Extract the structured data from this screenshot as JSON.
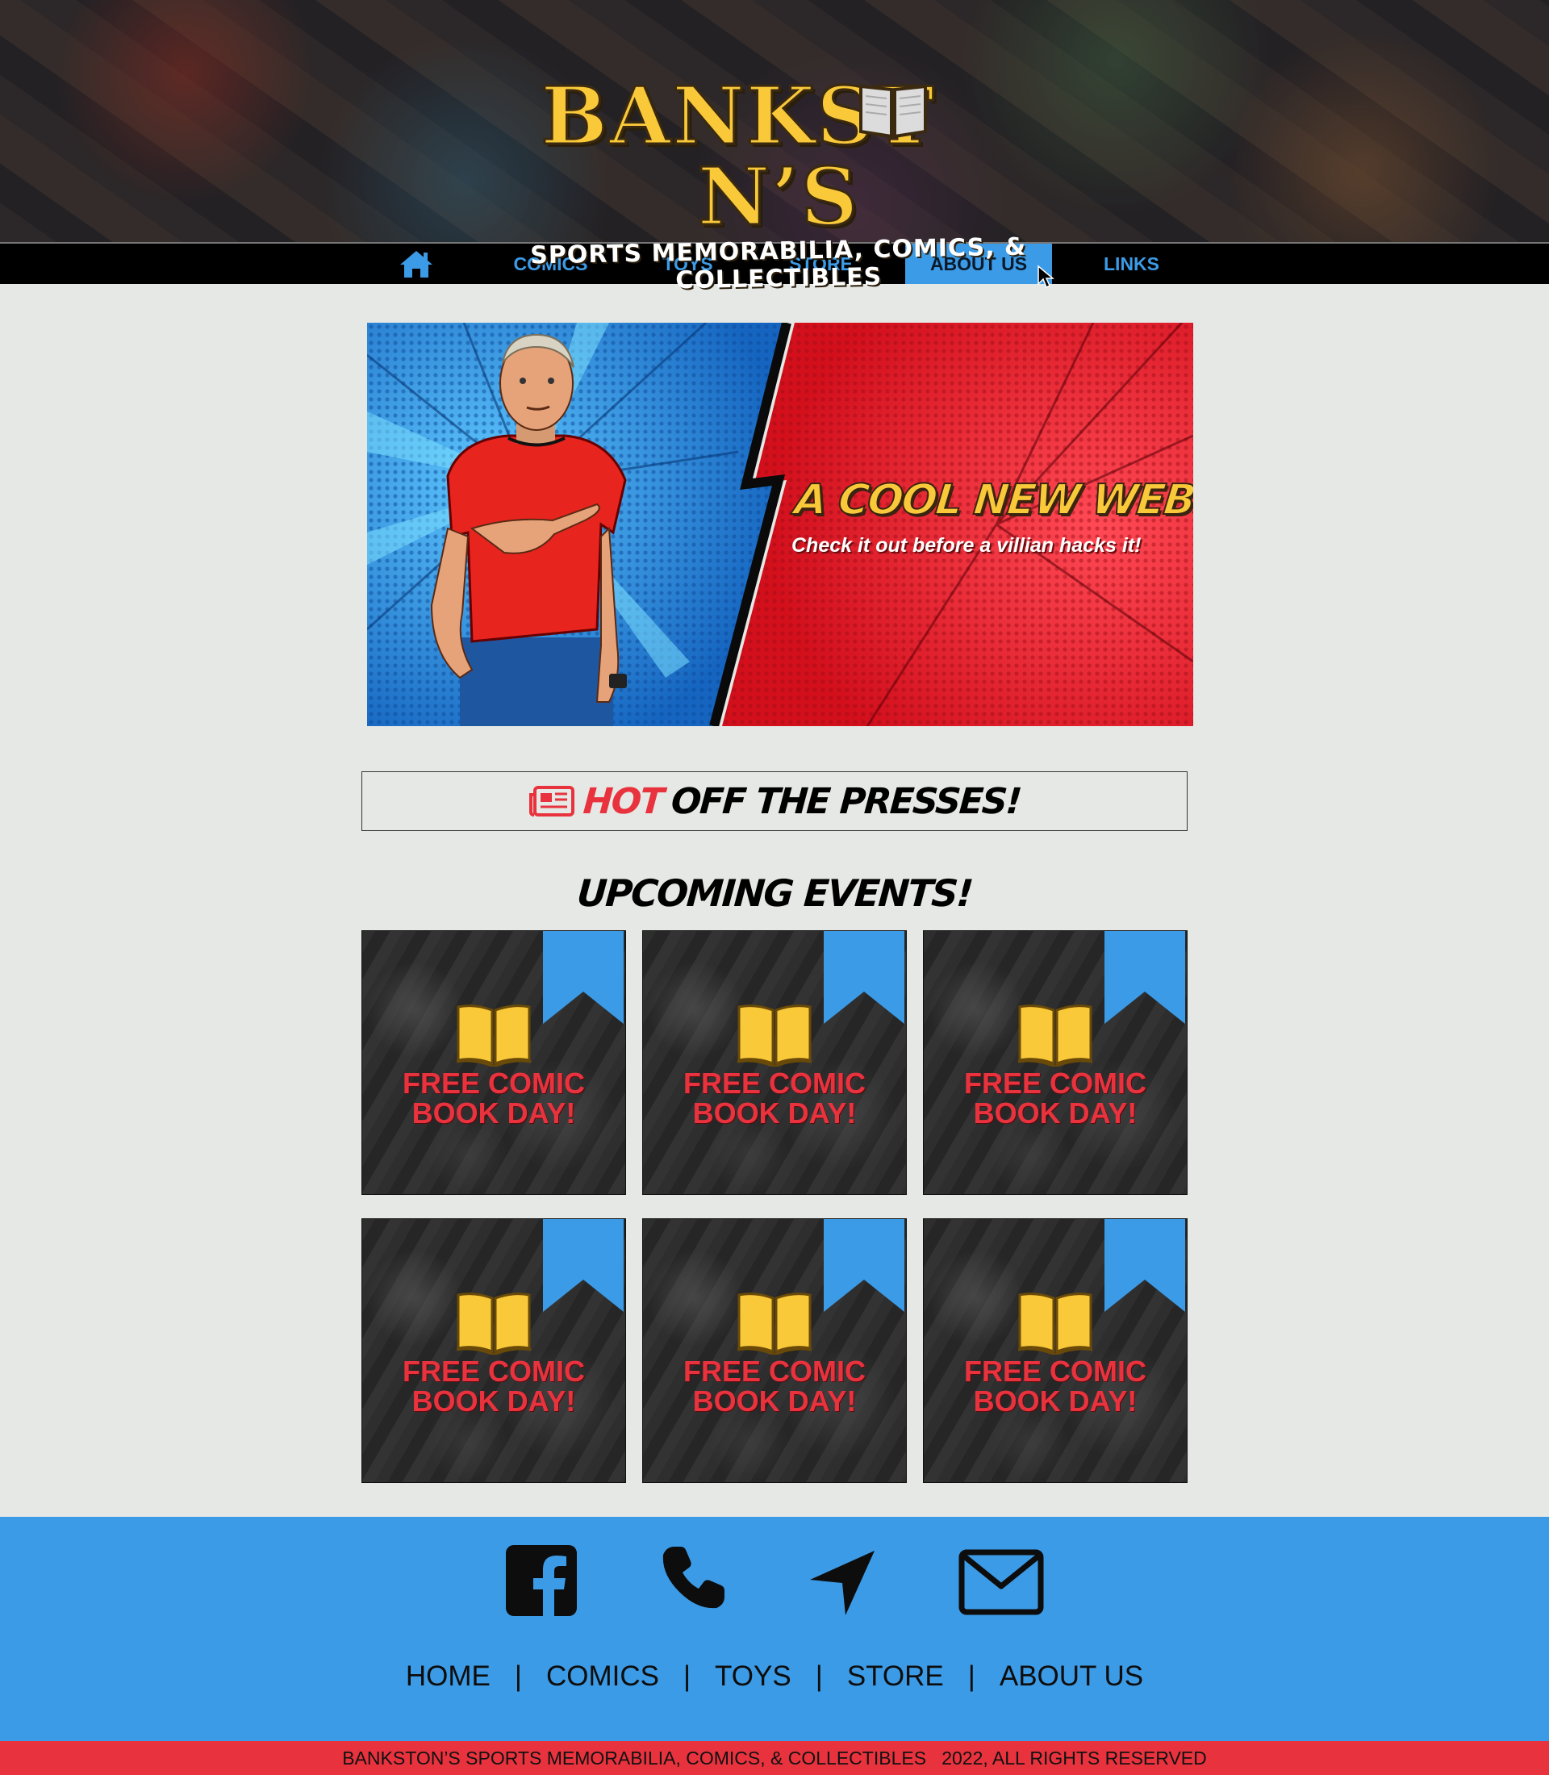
{
  "header": {
    "logo_title": "BANKST N’S",
    "logo_subtitle": "SPORTS MEMORABILIA, COMICS, & COLLECTIBLES"
  },
  "nav": {
    "home_icon": "home-icon",
    "items": [
      {
        "label": "COMICS"
      },
      {
        "label": "TOYS"
      },
      {
        "label": "STORE"
      },
      {
        "label": "ABOUT US",
        "active": true
      },
      {
        "label": "LINKS"
      }
    ]
  },
  "hero": {
    "headline": "A COOL NEW WEBSITE!",
    "subline": "Check it out before a villian hacks it!"
  },
  "hot_section": {
    "icon": "newspaper-icon",
    "hot_word": "HOT",
    "rest": "OFF THE PRESSES!"
  },
  "events": {
    "title": "UPCOMING EVENTS!",
    "cards": [
      {
        "line1": "FREE COMIC",
        "line2": "BOOK DAY!"
      },
      {
        "line1": "FREE COMIC",
        "line2": "BOOK DAY!"
      },
      {
        "line1": "FREE COMIC",
        "line2": "BOOK DAY!"
      },
      {
        "line1": "FREE COMIC",
        "line2": "BOOK DAY!"
      },
      {
        "line1": "FREE COMIC",
        "line2": "BOOK DAY!"
      },
      {
        "line1": "FREE COMIC",
        "line2": "BOOK DAY!"
      }
    ]
  },
  "footer": {
    "social_icons": [
      "facebook-icon",
      "phone-icon",
      "location-arrow-icon",
      "mail-icon"
    ],
    "links": [
      "HOME",
      "COMICS",
      "TOYS",
      "STORE",
      "ABOUT US"
    ],
    "separator": "|",
    "copyright": "BANKSTON’S SPORTS MEMORABILIA, COMICS, & COLLECTIBLES   2022, ALL RIGHTS RESERVED"
  },
  "colors": {
    "accent_blue": "#3c9be6",
    "accent_red": "#e8333e",
    "logo_yellow": "#f9c93a",
    "page_bg": "#e6e8e5"
  }
}
